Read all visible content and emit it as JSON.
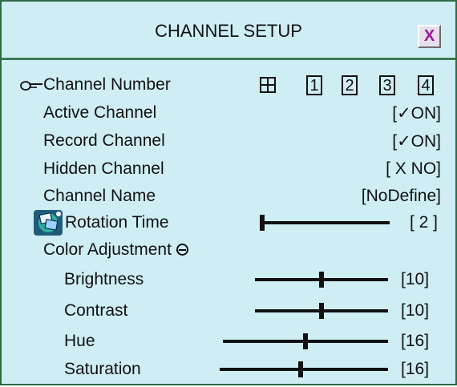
{
  "window": {
    "title": "CHANNEL SETUP",
    "close_label": "X"
  },
  "rows": {
    "channel_number": {
      "label": "Channel Number",
      "channels": [
        "1",
        "2",
        "3",
        "4"
      ]
    },
    "active_channel": {
      "label": "Active  Channel",
      "value": "[✓ON]"
    },
    "record_channel": {
      "label": "Record Channel",
      "value": "[✓ON]"
    },
    "hidden_channel": {
      "label": "Hidden Channel",
      "value": "[ X NO]"
    },
    "channel_name": {
      "label": "Channel Name",
      "value": "[NoDefine]"
    },
    "rotation_time": {
      "label": "Rotation Time",
      "value": "[ 2 ]",
      "level": 0.0
    },
    "color_adjustment": {
      "label": "Color Adjustment"
    },
    "brightness": {
      "label": "Brightness",
      "value": "[10]",
      "level": 0.5
    },
    "contrast": {
      "label": "Contrast",
      "value": "[10]",
      "level": 0.5
    },
    "hue": {
      "label": "Hue",
      "value": "[16]",
      "level": 0.5
    },
    "saturation": {
      "label": "Saturation",
      "value": "[16]",
      "level": 0.48
    }
  },
  "colors": {
    "panel_background": "#cfeef4",
    "border": "#2f6b45",
    "close_x": "#a0139b"
  },
  "icons": {
    "channel_pointer": "pointing-hand-icon",
    "quad_view": "quad-view-icon",
    "rotation": "rotation-icon",
    "collapse": "minus-circle-icon"
  }
}
